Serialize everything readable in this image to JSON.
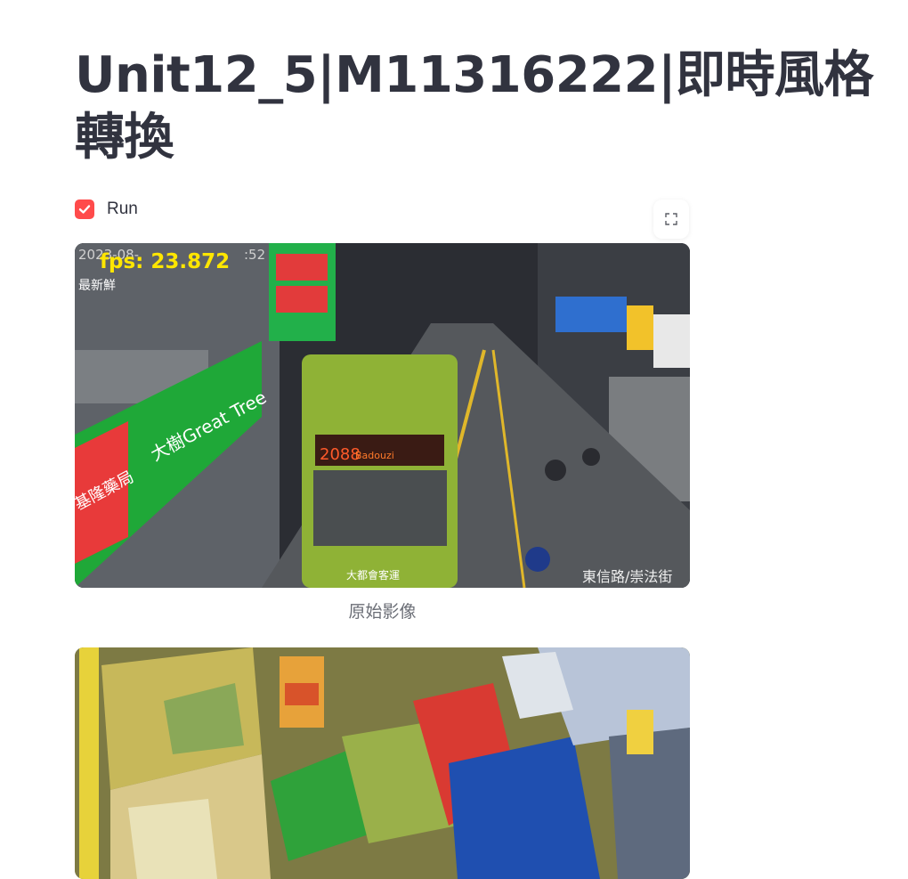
{
  "page": {
    "title": "Unit12_5|M11316222|即時風格轉換"
  },
  "controls": {
    "run_checkbox": {
      "label": "Run",
      "checked": true
    }
  },
  "images": {
    "original": {
      "caption": "原始影像",
      "overlay_fps": "fps: 23.872",
      "timestamp_partial": "2023-08-",
      "timestamp_tail": ":52",
      "location_label": "東信路/崇法街",
      "bus_route": "2088",
      "bus_dest": "Badouzi",
      "bus_company": "大都會客運",
      "shop_sign_left": "基隆藥局",
      "shop_brand": "大樹Great Tree",
      "sign_new": "最新鮮"
    },
    "styled": {
      "description_hidden": ""
    }
  },
  "colors": {
    "accent": "#ff4b4b",
    "fps_text": "#ffe600",
    "title": "#31333f",
    "caption": "#6b6e76"
  },
  "icons": {
    "fullscreen": "fullscreen-icon",
    "checkmark": "checkmark-icon"
  }
}
